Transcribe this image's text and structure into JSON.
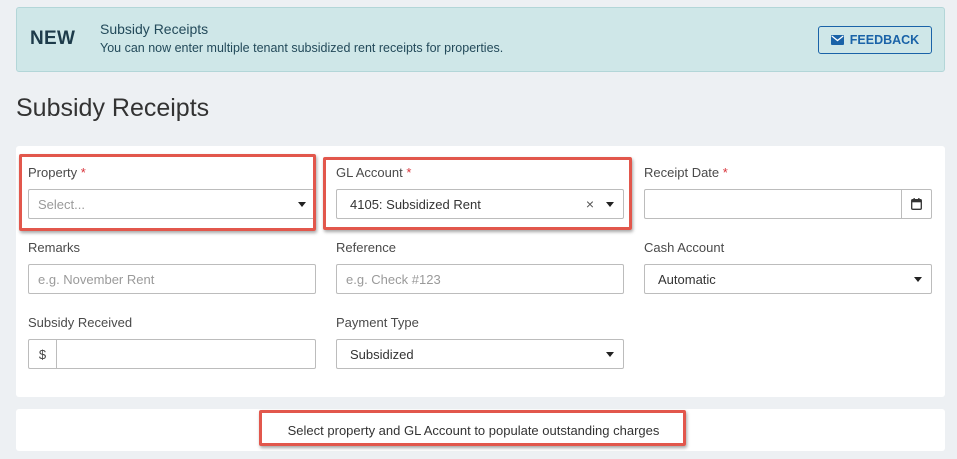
{
  "banner": {
    "tag": "NEW",
    "title": "Subsidy Receipts",
    "subtitle": "You can now enter multiple tenant subsidized rent receipts for properties.",
    "feedback_label": "FEEDBACK",
    "background": "#cfe7e8"
  },
  "page": {
    "title": "Subsidy Receipts"
  },
  "form": {
    "property": {
      "label": "Property",
      "required": "*",
      "placeholder": "Select...",
      "icon": "chevron-down-icon"
    },
    "gl_account": {
      "label": "GL Account",
      "required": "*",
      "value": "4105: Subsidized Rent",
      "clear": "×",
      "icon": "chevron-down-icon"
    },
    "receipt_date": {
      "label": "Receipt Date",
      "required": "*",
      "value": "",
      "icon": "calendar-icon"
    },
    "remarks": {
      "label": "Remarks",
      "placeholder": "e.g. November Rent"
    },
    "reference": {
      "label": "Reference",
      "placeholder": "e.g. Check #123"
    },
    "cash_account": {
      "label": "Cash Account",
      "value": "Automatic",
      "icon": "chevron-down-icon"
    },
    "subsidy_received": {
      "label": "Subsidy Received",
      "prefix": "$",
      "value": ""
    },
    "payment_type": {
      "label": "Payment Type",
      "value": "Subsidized",
      "icon": "chevron-down-icon"
    }
  },
  "charges": {
    "message": "Select property and GL Account to populate outstanding charges"
  },
  "colors": {
    "accent": "#1a63a8",
    "required": "#d8333a",
    "highlight": "#e2574c"
  }
}
